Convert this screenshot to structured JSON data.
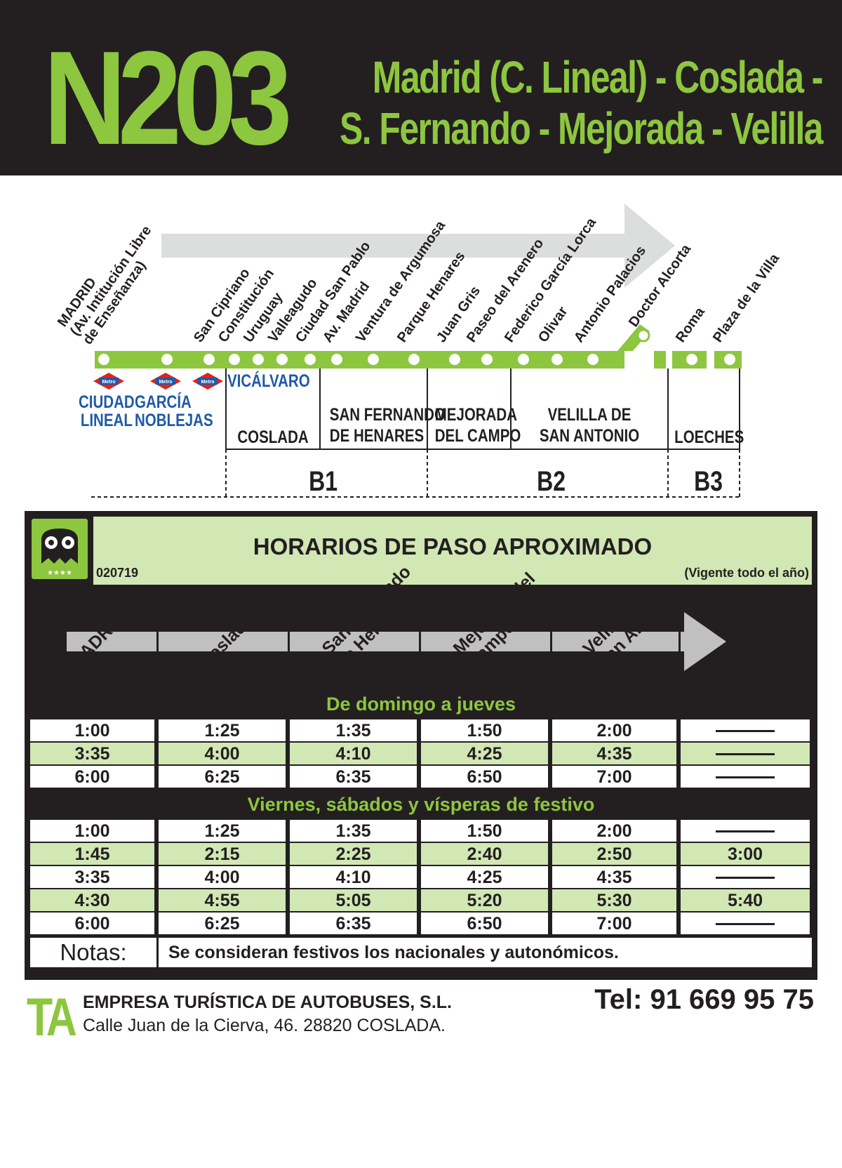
{
  "header": {
    "line_code": "N203",
    "route_line1": "Madrid (C. Lineal) - Coslada -",
    "route_line2": "S. Fernando - Mejorada - Velilla"
  },
  "colors": {
    "brand_green": "#8dc63f",
    "dark": "#231f20",
    "light_green": "#d1e7b4",
    "metro_red": "#e2231a",
    "metro_blue": "#1f5aa8"
  },
  "route_map": {
    "stops": [
      "MADRID\n(Av. Intitución Libre\nde Enseñanza)",
      "San Cipriano",
      "Constitución",
      "Uruguay",
      "Valleagudo",
      "Ciudad San Pablo",
      "Av. Madrid",
      "Ventura de Argumosa",
      "Parque Henares",
      "Juan Gris",
      "Paseo del Arenero",
      "Federico García Lorca",
      "Olivar",
      "Antonio Palacios",
      "Doctor Alcorta",
      "Roma",
      "Plaza de la Villa"
    ],
    "metro_stations": [
      "CIUDAD\nLINEAL",
      "GARCÍA\nNOBLEJAS",
      "VICÁLVARO"
    ],
    "metro_badge": "Metro",
    "zones": [
      "COSLADA",
      "SAN FERNANDO\nDE HENARES",
      "MEJORADA\nDEL CAMPO",
      "VELILLA DE\nSAN ANTONIO",
      "LOECHES"
    ],
    "fare_bands": [
      "B1",
      "B2",
      "B3"
    ]
  },
  "timetable": {
    "title": "HORARIOS DE PASO APROXIMADO",
    "code": "020719",
    "validity": "(Vigente todo el año)",
    "logo_icon": "owl-logo-icon",
    "columns": [
      "MADRID",
      "Coslada",
      "San Fernando\nde Henares",
      "Mejorada del\nCampo",
      "Velilla de\nSan Antonio",
      "Loeches"
    ],
    "sections": [
      {
        "title": "De domingo a jueves",
        "rows": [
          [
            "1:00",
            "1:25",
            "1:35",
            "1:50",
            "2:00",
            "—"
          ],
          [
            "3:35",
            "4:00",
            "4:10",
            "4:25",
            "4:35",
            "—"
          ],
          [
            "6:00",
            "6:25",
            "6:35",
            "6:50",
            "7:00",
            "—"
          ]
        ]
      },
      {
        "title": "Viernes, sábados y vísperas de festivo",
        "rows": [
          [
            "1:00",
            "1:25",
            "1:35",
            "1:50",
            "2:00",
            "—"
          ],
          [
            "1:45",
            "2:15",
            "2:25",
            "2:40",
            "2:50",
            "3:00"
          ],
          [
            "3:35",
            "4:00",
            "4:10",
            "4:25",
            "4:35",
            "—"
          ],
          [
            "4:30",
            "4:55",
            "5:05",
            "5:20",
            "5:30",
            "5:40"
          ],
          [
            "6:00",
            "6:25",
            "6:35",
            "6:50",
            "7:00",
            "—"
          ]
        ]
      }
    ],
    "notes_label": "Notas:",
    "notes_text": "Se consideran festivos los nacionales y autonómicos."
  },
  "footer": {
    "logo": "TA",
    "company": "EMPRESA TURÍSTICA DE AUTOBUSES, S.L.",
    "address": "Calle Juan de la Cierva, 46. 28820 COSLADA.",
    "phone": "Tel: 91 669 95 75"
  }
}
